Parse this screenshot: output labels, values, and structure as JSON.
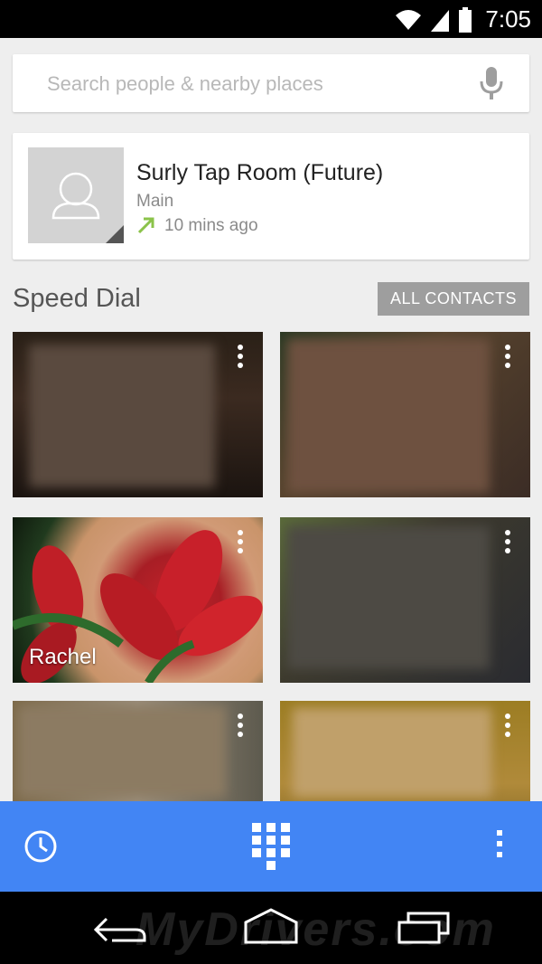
{
  "status_bar": {
    "time": "7:05"
  },
  "search": {
    "placeholder": "Search people & nearby places"
  },
  "recent_call": {
    "name": "Surly Tap Room (Future)",
    "type": "Main",
    "time_ago": "10 mins ago"
  },
  "speed_dial": {
    "title": "Speed Dial",
    "all_contacts_label": "ALL CONTACTS",
    "tiles": [
      {
        "name": ""
      },
      {
        "name": ""
      },
      {
        "name": "Rachel"
      },
      {
        "name": ""
      },
      {
        "name": ""
      },
      {
        "name": ""
      }
    ]
  },
  "watermark": "MyDrivers.com",
  "colors": {
    "accent": "#4285f4",
    "outgoing_arrow": "#8bc34a",
    "all_contacts_bg": "#9e9e9e"
  },
  "icons": {
    "status": [
      "wifi-icon",
      "signal-icon",
      "battery-icon"
    ],
    "search": "mic-icon",
    "bottom_bar": [
      "history-icon",
      "dialpad-icon",
      "overflow-menu-icon"
    ],
    "nav": [
      "back-icon",
      "home-icon",
      "recents-icon"
    ]
  }
}
